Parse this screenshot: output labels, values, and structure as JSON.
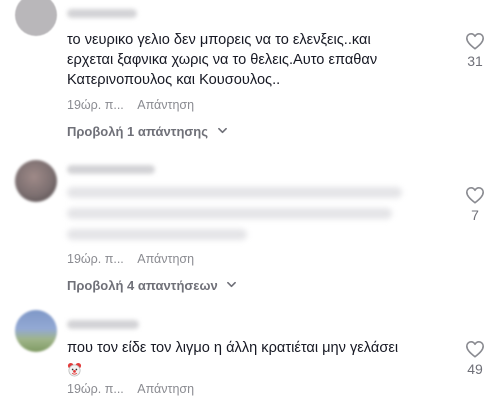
{
  "comments": [
    {
      "text_lines": [
        "το νευρικο γελιο δεν μπορεις να το ελενξεις..και",
        "ερχεται ξαφνικα χωρις να το θελεις.Αυτο επαθαν",
        "Κατερινοπουλος και Κουσουλος.."
      ],
      "time": "19ώρ. π...",
      "reply_label": "Απάντηση",
      "view_replies": "Προβολή 1 απάντησης",
      "likes": "31",
      "username_blurred": true
    },
    {
      "text_lines": [],
      "text_blurred": true,
      "time": "19ώρ. π...",
      "reply_label": "Απάντηση",
      "view_replies": "Προβολή 4 απαντήσεων",
      "likes": "7",
      "username_blurred": true
    },
    {
      "text_lines": [
        "που τον είδε τον λιγμο η άλλη κρατιέται μην γελάσει"
      ],
      "emoji": "clown-face",
      "time": "19ώρ. π...",
      "reply_label": "Απάντηση",
      "likes": "49",
      "username_blurred": true
    }
  ]
}
